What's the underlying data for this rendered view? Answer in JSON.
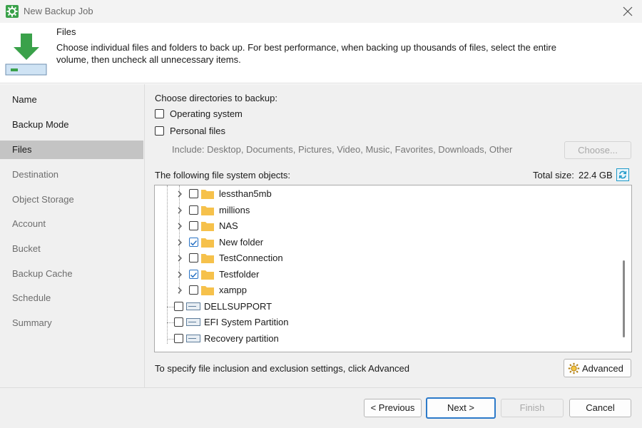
{
  "window": {
    "title": "New Backup Job",
    "close_icon": "close-icon"
  },
  "header": {
    "title": "Files",
    "description": "Choose individual files and folders to back up. For best performance, when backing up thousands of files, select the entire volume, then uncheck all unnecessary items."
  },
  "sidebar": {
    "items": [
      {
        "label": "Name",
        "state": "visited"
      },
      {
        "label": "Backup Mode",
        "state": "visited"
      },
      {
        "label": "Files",
        "state": "active"
      },
      {
        "label": "Destination",
        "state": "pending"
      },
      {
        "label": "Object Storage",
        "state": "pending"
      },
      {
        "label": "Account",
        "state": "pending"
      },
      {
        "label": "Bucket",
        "state": "pending"
      },
      {
        "label": "Backup Cache",
        "state": "pending"
      },
      {
        "label": "Schedule",
        "state": "pending"
      },
      {
        "label": "Summary",
        "state": "pending"
      }
    ]
  },
  "main": {
    "choose_label": "Choose directories to backup:",
    "os_label": "Operating system",
    "personal_label": "Personal files",
    "include_text": "Include: Desktop, Documents, Pictures, Video, Music, Favorites, Downloads, Other",
    "choose_button": "Choose...",
    "objects_label": "The following file system objects:",
    "total_size_label": "Total size:",
    "total_size_value": "22.4 GB",
    "tree": [
      {
        "label": "lessthan5mb",
        "checked": false,
        "type": "folder"
      },
      {
        "label": "millions",
        "checked": false,
        "type": "folder"
      },
      {
        "label": "NAS",
        "checked": false,
        "type": "folder"
      },
      {
        "label": "New folder",
        "checked": true,
        "type": "folder"
      },
      {
        "label": "TestConnection",
        "checked": false,
        "type": "folder"
      },
      {
        "label": "Testfolder",
        "checked": true,
        "type": "folder"
      },
      {
        "label": "xampp",
        "checked": false,
        "type": "folder"
      },
      {
        "label": "DELLSUPPORT",
        "checked": false,
        "type": "drive"
      },
      {
        "label": "EFI System Partition",
        "checked": false,
        "type": "drive"
      },
      {
        "label": "Recovery partition",
        "checked": false,
        "type": "drive"
      }
    ],
    "hint": "To specify file inclusion and exclusion settings, click Advanced",
    "advanced_button": "Advanced"
  },
  "footer": {
    "previous": "< Previous",
    "next": "Next >",
    "finish": "Finish",
    "cancel": "Cancel"
  },
  "colors": {
    "accent": "#2c7ac9",
    "check": "#2872c5",
    "folder": "#f6c14b",
    "refresh": "#1f9ac9",
    "sidebar_active": "#c4c4c4"
  }
}
